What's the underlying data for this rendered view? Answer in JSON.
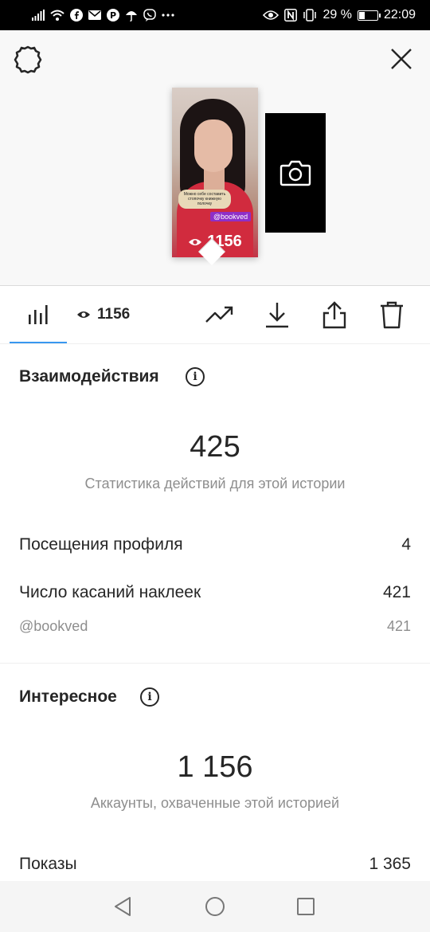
{
  "status_bar": {
    "battery_text": "29 %",
    "battery_level": 0.29,
    "time": "22:09",
    "left_icons": [
      "signal-icon",
      "wifi-icon",
      "facebook-icon",
      "mail-icon",
      "pinterest-icon",
      "umbrella-icon",
      "viber-icon",
      "more-dots-icon"
    ],
    "right_icons": [
      "eye-comfort-icon",
      "nfc-icon",
      "vibrate-icon"
    ]
  },
  "story": {
    "caption": "Можно себе составить стопочку книжную полочку",
    "tag": "@bookved",
    "views": "1156"
  },
  "toolbar": {
    "views": "1156"
  },
  "interactions": {
    "title": "Взаимодействия",
    "total": "425",
    "caption": "Статистика действий для этой истории",
    "rows": [
      {
        "label": "Посещения профиля",
        "value": "4"
      },
      {
        "label": "Число касаний наклеек",
        "value": "421"
      }
    ],
    "sub_row": {
      "label": "@bookved",
      "value": "421"
    }
  },
  "discovery": {
    "title": "Интересное",
    "total": "1 156",
    "caption": "Аккаунты, охваченные этой историей",
    "rows": [
      {
        "label": "Показы",
        "value": "1 365"
      }
    ]
  },
  "colors": {
    "accent": "#3897f0",
    "text": "#262626",
    "muted": "#8e8e8e",
    "tag": "#8e2fc7"
  }
}
